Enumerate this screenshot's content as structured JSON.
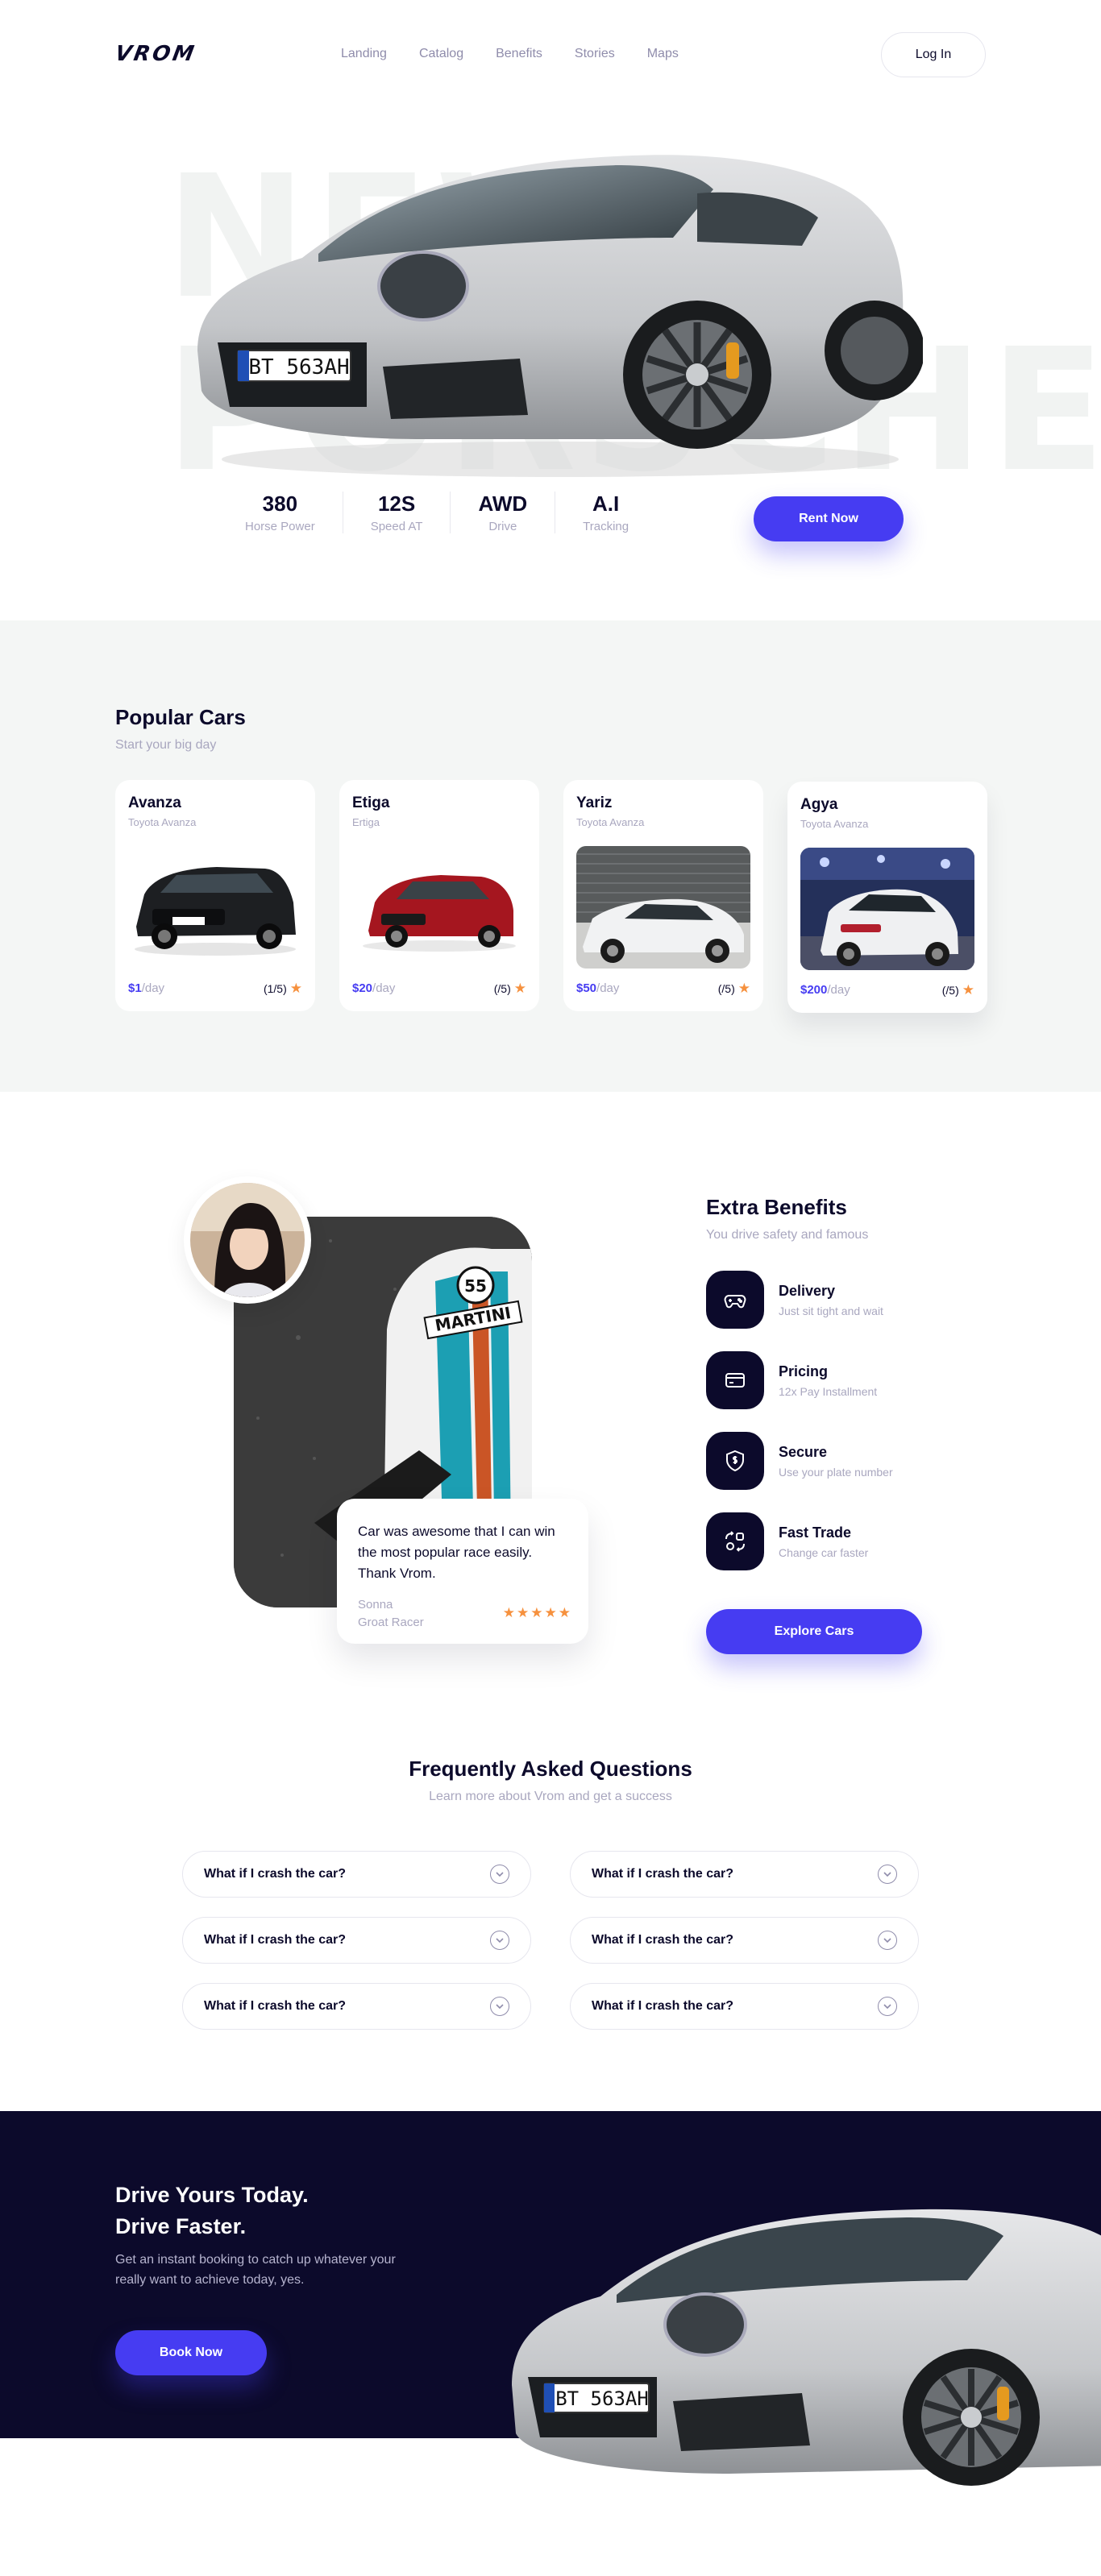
{
  "header": {
    "logo": "VROM",
    "nav": [
      "Landing",
      "Catalog",
      "Benefits",
      "Stories",
      "Maps"
    ],
    "login_label": "Log In"
  },
  "hero": {
    "bg_line1": "NEW",
    "bg_line2": "PORSCHE",
    "plate": "BT 563AH",
    "specs": [
      {
        "value": "380",
        "label": "Horse Power"
      },
      {
        "value": "12S",
        "label": "Speed AT"
      },
      {
        "value": "AWD",
        "label": "Drive"
      },
      {
        "value": "A.I",
        "label": "Tracking"
      }
    ],
    "rent_label": "Rent Now"
  },
  "popular": {
    "title": "Popular Cars",
    "subtitle": "Start your big day",
    "cars": [
      {
        "name": "Avanza",
        "model": "Toyota Avanza",
        "price": "$1",
        "per": "/day",
        "rating": "(1/5)"
      },
      {
        "name": "Etiga",
        "model": "Ertiga",
        "price": "$20",
        "per": "/day",
        "rating": "(/5)"
      },
      {
        "name": "Yariz",
        "model": "Toyota Avanza",
        "price": "$50",
        "per": "/day",
        "rating": "(/5)"
      },
      {
        "name": "Agya",
        "model": "Toyota Avanza",
        "price": "$200",
        "per": "/day",
        "rating": "(/5)"
      }
    ]
  },
  "benefits": {
    "title": "Extra Benefits",
    "subtitle": "You drive safety and famous",
    "items": [
      {
        "title": "Delivery",
        "desc": "Just sit tight and wait",
        "icon": "gamepad-icon"
      },
      {
        "title": "Pricing",
        "desc": "12x Pay Installment",
        "icon": "card-icon"
      },
      {
        "title": "Secure",
        "desc": "Use your plate number",
        "icon": "shield-icon"
      },
      {
        "title": "Fast Trade",
        "desc": "Change car faster",
        "icon": "swap-icon"
      }
    ],
    "explore_label": "Explore Cars",
    "review": {
      "text": "Car was awesome that I can win the most popular race easily. Thank Vrom.",
      "name": "Sonna",
      "role": "Groat Racer",
      "stars": "★★★★★"
    },
    "martini_text": "MARTINI",
    "car_number": "55"
  },
  "faq": {
    "title": "Frequently Asked Questions",
    "subtitle": "Learn more about Vrom and get a success",
    "questions": [
      "What if I crash the car?",
      "What if I crash the car?",
      "What if I crash the car?",
      "What if I crash the car?",
      "What if I crash the car?",
      "What if I crash the car?"
    ]
  },
  "cta": {
    "title_line1": "Drive Yours Today.",
    "title_line2": "Drive Faster.",
    "description": "Get an instant booking to catch up whatever your really want to achieve today, yes.",
    "book_label": "Book Now",
    "plate": "BT 563AH"
  },
  "colors": {
    "primary": "#463cf2",
    "navy": "#0c0a2b",
    "muted": "#a9a7bf",
    "star": "#f6913e",
    "section_bg": "#f4f6f5"
  }
}
